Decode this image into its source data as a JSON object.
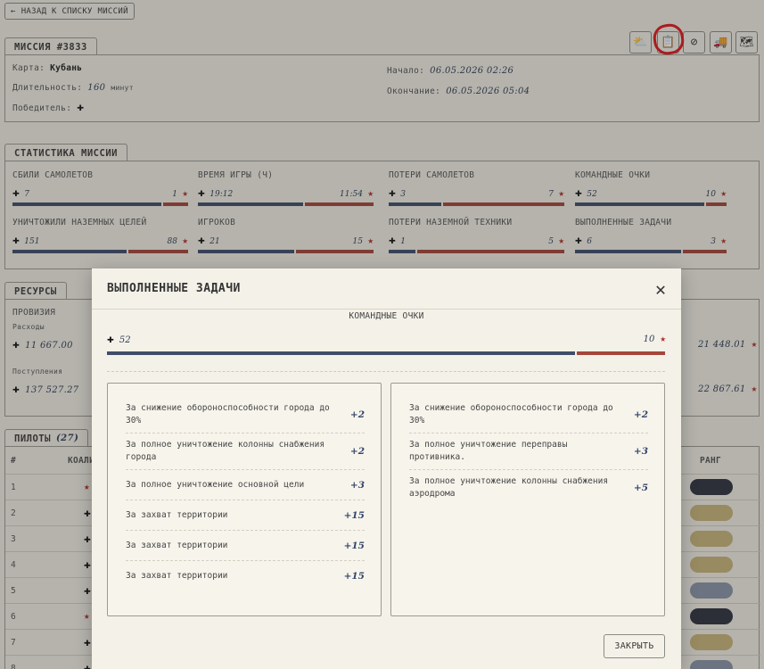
{
  "back_label": "НАЗАД К СПИСКУ МИССИЙ",
  "mission": {
    "tab": "МИССИЯ #3833",
    "map_label": "Карта:",
    "map_value": "Кубань",
    "duration_label": "Длительность:",
    "duration_value": "160",
    "duration_unit": "минут",
    "winner_label": "Победитель:",
    "start_label": "Начало:",
    "start_value": "06.05.2026 02:26",
    "end_label": "Окончание:",
    "end_value": "06.05.2026 05:04"
  },
  "stats": {
    "tab": "СТАТИСТИКА МИССИИ",
    "items": [
      {
        "title": "СБИЛИ САМОЛЕТОВ",
        "left": "7",
        "right": "1"
      },
      {
        "title": "ВРЕМЯ ИГРЫ (Ч)",
        "left": "19:12",
        "right": "11:54"
      },
      {
        "title": "ПОТЕРИ САМОЛЕТОВ",
        "left": "3",
        "right": "7"
      },
      {
        "title": "КОМАНДНЫЕ ОЧКИ",
        "left": "52",
        "right": "10"
      },
      {
        "title": "УНИЧТОЖИЛИ НАЗЕМНЫХ ЦЕЛЕЙ",
        "left": "151",
        "right": "88"
      },
      {
        "title": "ИГРОКОВ",
        "left": "21",
        "right": "15"
      },
      {
        "title": "ПОТЕРИ НАЗЕМНОЙ ТЕХНИКИ",
        "left": "1",
        "right": "5"
      },
      {
        "title": "ВЫПОЛНЕННЫЕ ЗАДАЧИ",
        "left": "6",
        "right": "3"
      }
    ]
  },
  "resources": {
    "tab": "РЕСУРСЫ",
    "provision": "ПРОВИЗИЯ",
    "expenses": "Расходы",
    "expenses_left": "11 667.00",
    "expenses_right": "21 448.01",
    "income": "Поступления",
    "income_left": "137 527.27",
    "income_right": "22 867.61"
  },
  "pilots": {
    "tab": "ПИЛОТЫ",
    "count": "(27)",
    "col_num": "#",
    "col_name": "КОАЛИ",
    "col_rank": "РАНГ",
    "rows": [
      "1",
      "2",
      "3",
      "4",
      "5",
      "6",
      "7",
      "8"
    ]
  },
  "modal": {
    "title": "ВЫПОЛНЕННЫЕ ЗАДАЧИ",
    "score_label": "КОМАНДНЫЕ ОЧКИ",
    "score_left": "52",
    "score_right": "10",
    "left_tasks": [
      {
        "text": "За снижение обороноспособности города до 30%",
        "pts": "+2"
      },
      {
        "text": "За полное уничтожение колонны снабжения города",
        "pts": "+2"
      },
      {
        "text": "За полное уничтожение основной цели",
        "pts": "+3"
      },
      {
        "text": "За захват территории",
        "pts": "+15"
      },
      {
        "text": "За захват территории",
        "pts": "+15"
      },
      {
        "text": "За захват территории",
        "pts": "+15"
      }
    ],
    "right_tasks": [
      {
        "text": "За снижение обороноспособности города до 30%",
        "pts": "+2"
      },
      {
        "text": "За полное уничтожение переправы противника.",
        "pts": "+3"
      },
      {
        "text": "За полное уничтожение колонны снабжения аэродрома",
        "pts": "+5"
      }
    ],
    "close_label": "ЗАКРЫТЬ"
  },
  "colors": {
    "allied": "#3f4d6a",
    "axis": "#a5463a",
    "annotation": "#e3181d"
  }
}
